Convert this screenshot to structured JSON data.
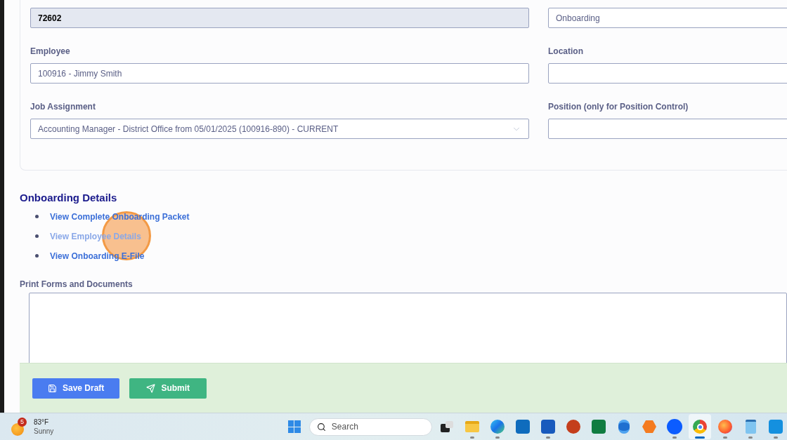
{
  "form": {
    "left_fields": [
      {
        "kind": "readonly",
        "value": "72602"
      },
      {
        "kind": "text",
        "label": "Employee",
        "value": "100916 - Jimmy Smith"
      },
      {
        "kind": "select",
        "label": "Job Assignment",
        "value": "Accounting Manager - District Office from 05/01/2025 (100916-890) - CURRENT"
      }
    ],
    "right_fields": [
      {
        "kind": "text",
        "value": "Onboarding"
      },
      {
        "kind": "text",
        "label": "Location"
      },
      {
        "kind": "text",
        "label": "Position (only for Position Control)"
      }
    ]
  },
  "onboarding": {
    "title": "Onboarding Details",
    "links": [
      {
        "label": "View Complete Onboarding Packet",
        "hovered": false
      },
      {
        "label": "View Employee Details",
        "hovered": true
      },
      {
        "label": "View Onboarding E-File",
        "hovered": false
      }
    ]
  },
  "print_forms": {
    "label": "Print Forms and Documents"
  },
  "buttons": [
    {
      "kind": "save",
      "label": "Save Draft"
    },
    {
      "kind": "submit",
      "label": "Submit"
    }
  ],
  "taskbar": {
    "weather": {
      "badge": "5",
      "temp": "83°F",
      "condition": "Sunny"
    },
    "search": {
      "placeholder": "Search"
    },
    "apps": [
      {
        "kind": "taskview",
        "running": false,
        "active": false
      },
      {
        "kind": "folder",
        "running": true,
        "active": false
      },
      {
        "kind": "browser-wave",
        "running": true,
        "active": false
      },
      {
        "kind": "mail",
        "running": false,
        "active": false
      },
      {
        "kind": "doc",
        "running": true,
        "active": false
      },
      {
        "kind": "slides",
        "running": false,
        "active": false
      },
      {
        "kind": "sheet",
        "running": false,
        "active": false
      },
      {
        "kind": "database",
        "running": false,
        "active": false
      },
      {
        "kind": "hexagon",
        "running": false,
        "active": false
      },
      {
        "kind": "video",
        "running": true,
        "active": false
      },
      {
        "kind": "chrome",
        "running": true,
        "active": true
      },
      {
        "kind": "fox",
        "running": true,
        "active": false
      },
      {
        "kind": "notepad",
        "running": true,
        "active": false
      },
      {
        "kind": "mail2",
        "running": true,
        "active": false
      }
    ]
  }
}
